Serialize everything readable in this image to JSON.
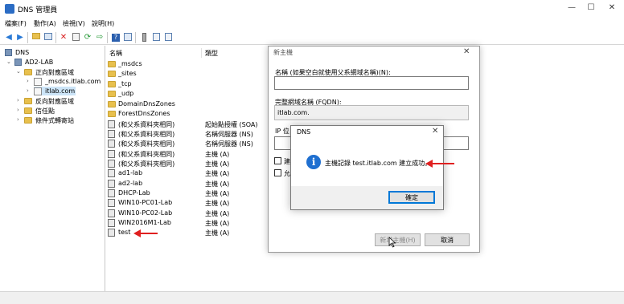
{
  "window": {
    "title": "DNS 管理員",
    "controls": {
      "minimize": "—",
      "maximize": "☐",
      "close": "✕"
    }
  },
  "menu": [
    "檔案(F)",
    "動作(A)",
    "檢視(V)",
    "說明(H)"
  ],
  "tree": {
    "root": "DNS",
    "server": "AD2-LAB",
    "forward_zones": "正向對應區域",
    "msdcs_zone": "_msdcs.itlab.com",
    "itlab_zone": "itlab.com",
    "reverse_zones": "反向對應區域",
    "trust_points": "信任點",
    "conditional_forwarders": "條件式轉寄站"
  },
  "list": {
    "col_name": "名稱",
    "col_type": "類型",
    "folders": [
      "_msdcs",
      "_sites",
      "_tcp",
      "_udp",
      "DomainDnsZones",
      "ForestDnsZones"
    ],
    "records": [
      {
        "name": "(和父系資料夾相同)",
        "type": "起始點授權 (SOA)"
      },
      {
        "name": "(和父系資料夾相同)",
        "type": "名稱伺服器 (NS)"
      },
      {
        "name": "(和父系資料夾相同)",
        "type": "名稱伺服器 (NS)"
      },
      {
        "name": "(和父系資料夾相同)",
        "type": "主機 (A)"
      },
      {
        "name": "(和父系資料夾相同)",
        "type": "主機 (A)"
      },
      {
        "name": "ad1-lab",
        "type": "主機 (A)"
      },
      {
        "name": "ad2-lab",
        "type": "主機 (A)"
      },
      {
        "name": "DHCP-Lab",
        "type": "主機 (A)"
      },
      {
        "name": "WIN10-PC01-Lab",
        "type": "主機 (A)"
      },
      {
        "name": "WIN10-PC02-Lab",
        "type": "主機 (A)"
      },
      {
        "name": "WIN2016M1-Lab",
        "type": "主機 (A)"
      },
      {
        "name": "test",
        "type": "主機 (A)"
      }
    ]
  },
  "new_host_dialog": {
    "title": "新主機",
    "name_label": "名稱 (如果空白就使用父系網域名稱)(N):",
    "name_value": "",
    "fqdn_label": "完整網域名稱 (FQDN):",
    "fqdn_value": "itlab.com.",
    "ip_label": "IP 位",
    "check1_label": "建",
    "check2_label": "允",
    "add_button": "新增主機(H)",
    "cancel_button": "取消",
    "close": "✕"
  },
  "message_box": {
    "title": "DNS",
    "message": "主機記錄 test.itlab.com 建立成功。",
    "ok_button": "確定",
    "close": "✕",
    "icon_glyph": "i"
  },
  "colors": {
    "arrow": "#e02020",
    "info_icon": "#1f6fd0",
    "selection": "#cce4f7",
    "folder": "#e8c04d"
  }
}
